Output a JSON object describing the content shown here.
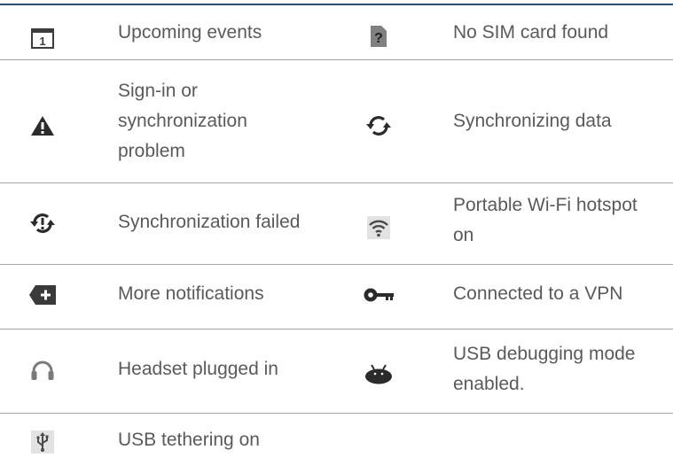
{
  "table": {
    "rows": [
      {
        "left": {
          "icon": "calendar-icon",
          "icon_text": "1",
          "label": "Upcoming events"
        },
        "right": {
          "icon": "no-sim-icon",
          "icon_text": "?",
          "label": "No SIM card found"
        }
      },
      {
        "left": {
          "icon": "warning-icon",
          "label_lines": [
            "Sign-in or",
            "synchronization",
            "problem"
          ]
        },
        "right": {
          "icon": "sync-icon",
          "label": "Synchronizing data"
        }
      },
      {
        "left": {
          "icon": "sync-failed-icon",
          "label": "Synchronization failed"
        },
        "right": {
          "icon": "wifi-hotspot-icon",
          "label_lines": [
            "Portable Wi-Fi hotspot",
            "on"
          ]
        }
      },
      {
        "left": {
          "icon": "more-notifications-icon",
          "label": "More notifications"
        },
        "right": {
          "icon": "vpn-key-icon",
          "label": "Connected to a VPN"
        }
      },
      {
        "left": {
          "icon": "headset-icon",
          "label": "Headset plugged in"
        },
        "right": {
          "icon": "usb-debugging-icon",
          "label_lines": [
            "USB debugging mode",
            "enabled."
          ]
        }
      },
      {
        "left": {
          "icon": "usb-icon",
          "label": "USB tethering on"
        }
      }
    ]
  },
  "colors": {
    "rule": "#2a4d80",
    "separator": "#a6a6a6",
    "text": "#5a5a5a",
    "icon": "#3c3c3c"
  }
}
